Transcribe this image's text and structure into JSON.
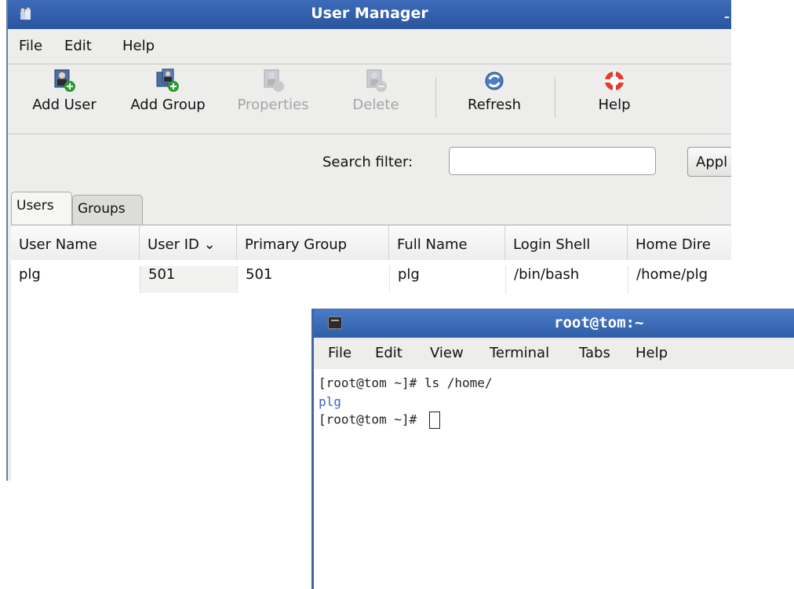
{
  "user_manager": {
    "title": "User Manager",
    "minimize": "–",
    "menu": [
      "File",
      "Edit",
      "Help"
    ],
    "toolbar": {
      "add_user": "Add User",
      "add_group": "Add Group",
      "properties": "Properties",
      "delete": "Delete",
      "refresh": "Refresh",
      "help": "Help"
    },
    "search_label": "Search filter:",
    "search_value": "",
    "apply_label": "Appl",
    "tabs": [
      "Users",
      "Groups"
    ],
    "columns": [
      "User Name",
      "User ID ⌄",
      "Primary Group",
      "Full Name",
      "Login Shell",
      "Home Dire"
    ],
    "rows": [
      [
        "plg",
        "501",
        "501",
        "plg",
        "/bin/bash",
        "/home/plg"
      ]
    ],
    "colors": {
      "titlebar": "#2f5ea8",
      "add_badge": "#2e9a2e"
    }
  },
  "terminal": {
    "title": "root@tom:~",
    "menu": [
      "File",
      "Edit",
      "View",
      "Terminal",
      "Tabs",
      "Help"
    ],
    "lines": [
      "[root@tom ~]# ls /home/",
      "plg",
      "[root@tom ~]# "
    ],
    "colors": {
      "directory": "#3a63c9"
    }
  },
  "icons": {
    "app": "user-manager-app-icon",
    "add_user": "add-user-icon",
    "add_group": "add-group-icon",
    "properties": "properties-icon",
    "delete": "delete-icon",
    "refresh": "refresh-icon",
    "help": "help-lifebuoy-icon",
    "terminal": "terminal-app-icon"
  }
}
